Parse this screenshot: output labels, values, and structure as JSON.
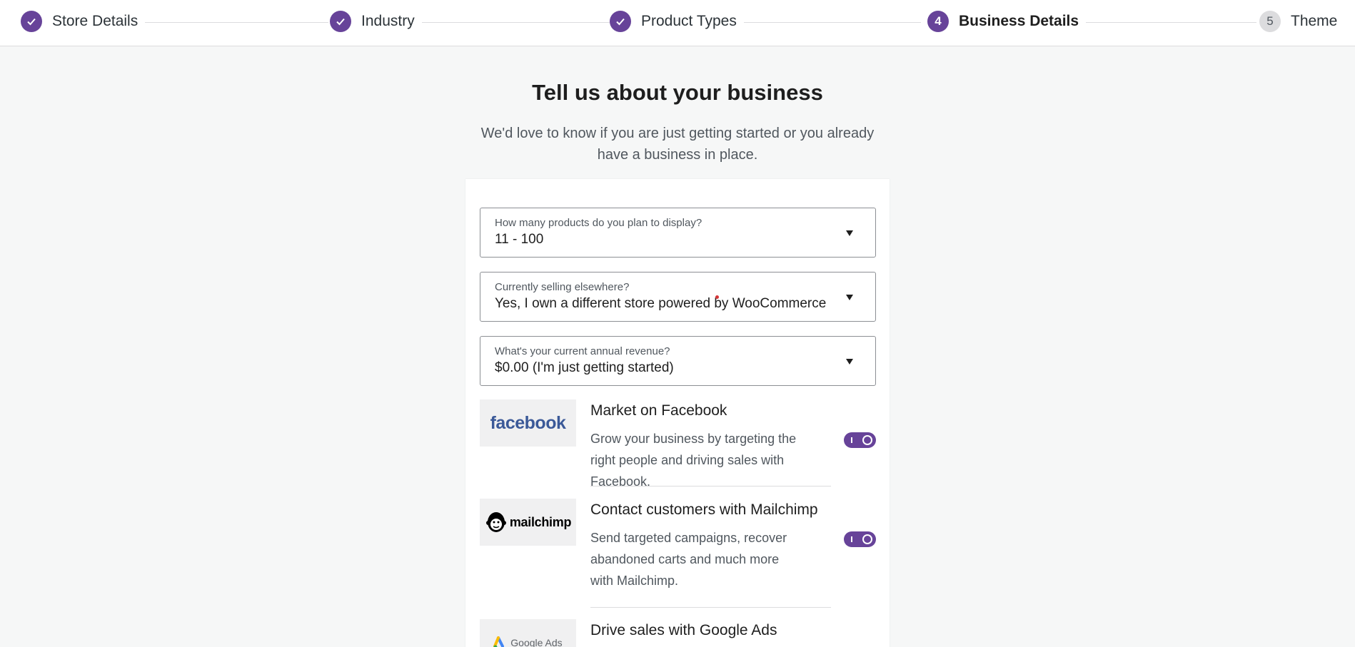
{
  "stepper": {
    "steps": [
      {
        "label": "Store Details",
        "state": "done"
      },
      {
        "label": "Industry",
        "state": "done"
      },
      {
        "label": "Product Types",
        "state": "done"
      },
      {
        "number": "4",
        "label": "Business Details",
        "state": "current"
      },
      {
        "number": "5",
        "label": "Theme",
        "state": "todo"
      }
    ]
  },
  "header": {
    "title": "Tell us about your business",
    "subtitle": "We'd love to know if you are just getting started or you already have a business in place."
  },
  "form": {
    "products": {
      "label": "How many products do you plan to display?",
      "value": "11 - 100"
    },
    "selling": {
      "label": "Currently selling elsewhere?",
      "value": "Yes, I own a different store powered by WooCommerce"
    },
    "revenue": {
      "label": "What's your current annual revenue?",
      "value": "$0.00 (I'm just getting started)"
    }
  },
  "extensions": [
    {
      "logo": "facebook",
      "title": "Market on Facebook",
      "description": "Grow your business by targeting the right people and driving sales with Facebook.",
      "enabled": true
    },
    {
      "logo": "mailchimp",
      "title": "Contact customers with Mailchimp",
      "description": "Send targeted campaigns, recover abandoned carts and much more with Mailchimp.",
      "enabled": true
    },
    {
      "logo": "Google Ads",
      "title": "Drive sales with Google Ads",
      "description": "",
      "enabled": true
    }
  ],
  "colors": {
    "accent": "#674399",
    "facebook": "#3b5998"
  }
}
